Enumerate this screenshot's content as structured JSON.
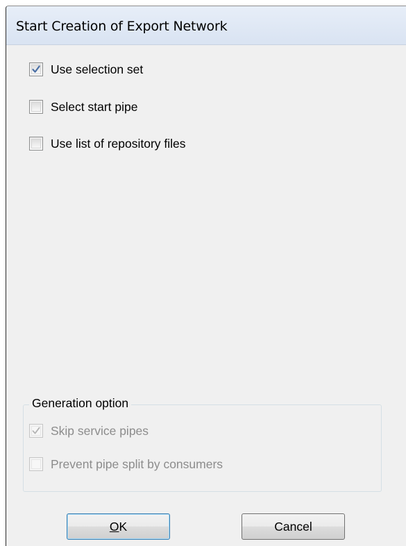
{
  "dialog": {
    "title": "Start Creation of Export Network"
  },
  "options": [
    {
      "label": "Use selection set",
      "checked": true
    },
    {
      "label": "Select start pipe",
      "checked": false
    },
    {
      "label": "Use list of repository files",
      "checked": false
    }
  ],
  "generation_option": {
    "title": "Generation option",
    "items": [
      {
        "label": "Skip service pipes",
        "checked": true,
        "enabled": false
      },
      {
        "label": "Prevent pipe split by consumers",
        "checked": false,
        "enabled": false
      }
    ]
  },
  "buttons": {
    "ok_label_access": "O",
    "ok_label_rest": "K",
    "cancel_label": "Cancel"
  },
  "colors": {
    "check_mark": "#4a6fa5",
    "check_mark_disabled": "#b4b4b4",
    "default_button_border": "#3c7fb1"
  }
}
